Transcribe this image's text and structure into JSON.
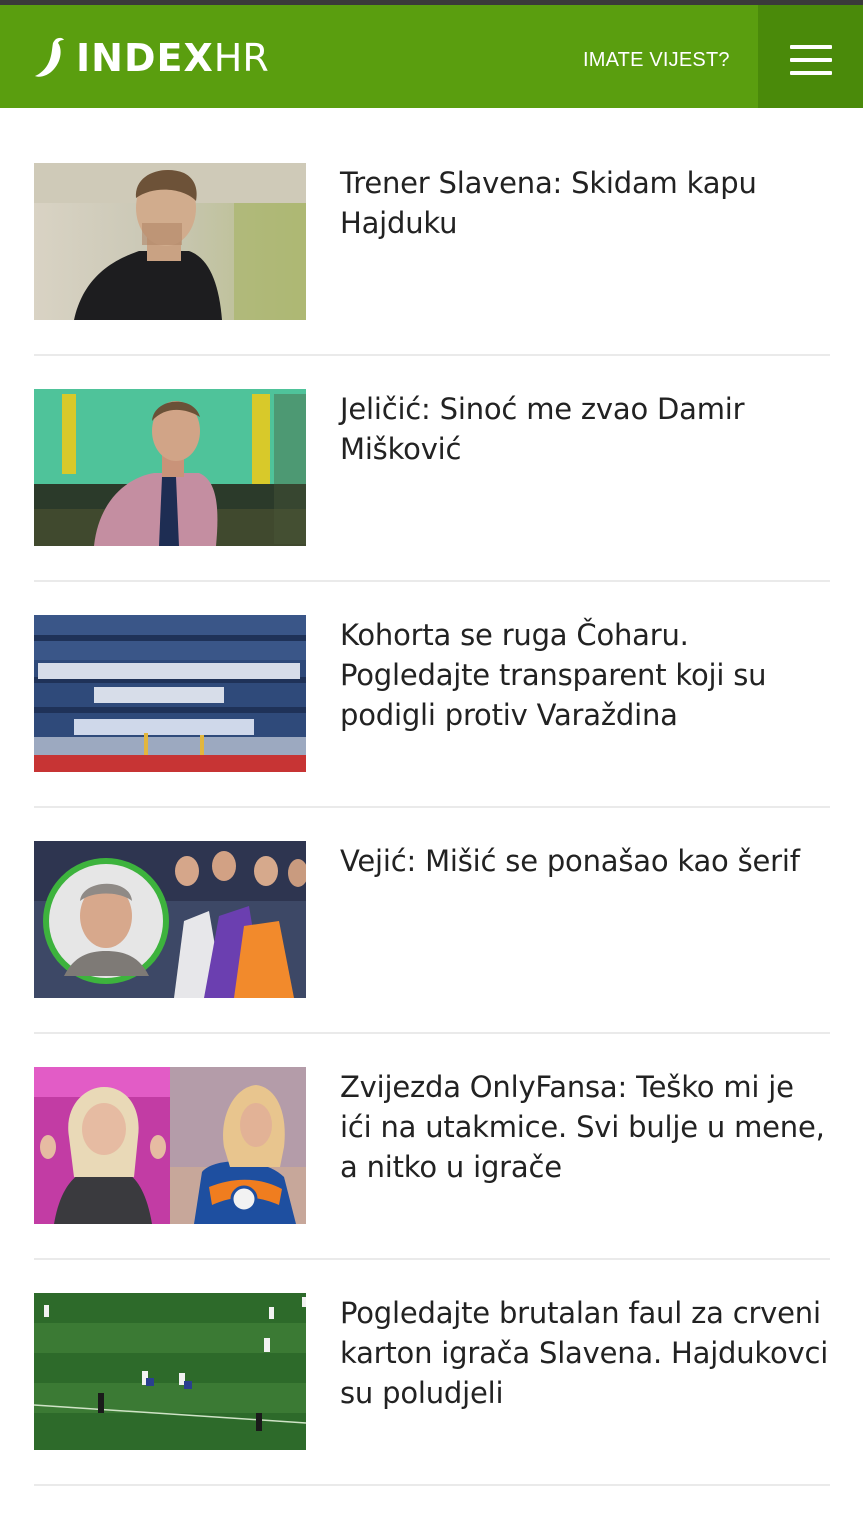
{
  "header": {
    "logo_text": "INDEX",
    "logo_suffix": "HR",
    "tip_link": "IMATE VIJEST?",
    "menu_icon": "hamburger-menu-icon",
    "brand_color": "#5a9e0f",
    "menu_bg_color": "#4a8a0a"
  },
  "articles": [
    {
      "title": "Trener Slavena: Skidam kapu Hajduku"
    },
    {
      "title": "Jeličić: Sinoć me zvao Damir Mišković"
    },
    {
      "title": "Kohorta se ruga Čoharu. Pogledajte transparent koji su podigli protiv Varaždina"
    },
    {
      "title": "Vejić: Mišić se ponašao kao šerif"
    },
    {
      "title": "Zvijezda OnlyFansa: Teško mi je ići na utakmice. Svi bulje u mene, a nitko u igrače"
    },
    {
      "title": "Pogledajte brutalan faul za crveni karton igrača Slavena. Hajdukovci su poludjeli"
    }
  ]
}
